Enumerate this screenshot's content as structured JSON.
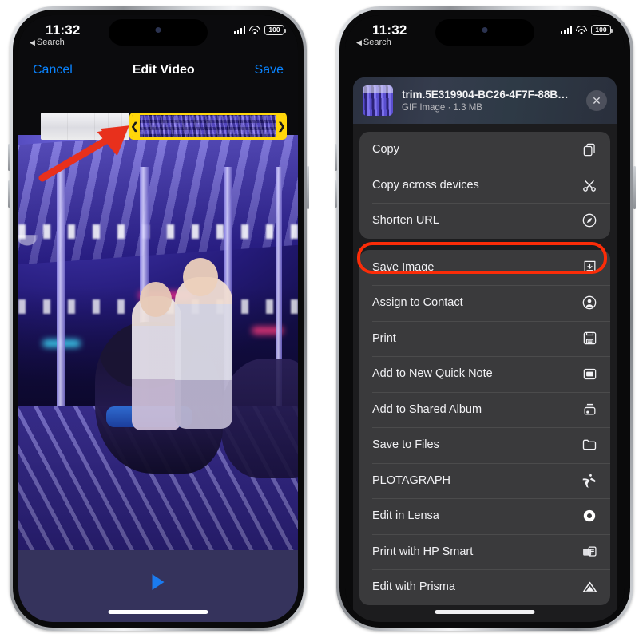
{
  "left_phone": {
    "status_bar": {
      "time": "11:32",
      "back_label": "Search",
      "back_caret": "◀",
      "signal_icon": "cellular-signal-icon",
      "wifi_icon": "wifi-icon",
      "battery_level": "100"
    },
    "navbar": {
      "cancel_label": "Cancel",
      "title": "Edit Video",
      "save_label": "Save"
    },
    "trimmer": {
      "left_handle_glyph": "❮",
      "right_handle_glyph": "❯",
      "selection_border_color": "#ffd60a"
    },
    "player": {
      "play_icon": "play-icon"
    },
    "annotation": {
      "arrow_color": "#e8301c",
      "arrow_name": "red-pointer-arrow"
    }
  },
  "right_phone": {
    "status_bar": {
      "time": "11:32",
      "back_label": "Search",
      "back_caret": "◀",
      "signal_icon": "cellular-signal-icon",
      "wifi_icon": "wifi-icon",
      "battery_level": "100"
    },
    "share_sheet": {
      "header": {
        "file_name": "trim.5E319904-BC26-4F7F-88B…",
        "file_meta": "GIF Image · 1.3 MB",
        "thumbnail_name": "file-thumbnail",
        "close_glyph": "✕"
      },
      "groups": [
        {
          "name": "actions-group-1",
          "items": [
            {
              "label": "Copy",
              "icon": "copy-icon"
            },
            {
              "label": "Copy across devices",
              "icon": "scissors-icon"
            },
            {
              "label": "Shorten URL",
              "icon": "compass-icon"
            }
          ]
        },
        {
          "name": "actions-group-2",
          "items": [
            {
              "label": "Save Image",
              "icon": "save-download-icon",
              "highlighted": true
            },
            {
              "label": "Assign to Contact",
              "icon": "person-circle-icon"
            },
            {
              "label": "Print",
              "icon": "printer-icon"
            },
            {
              "label": "Add to New Quick Note",
              "icon": "quick-note-icon"
            },
            {
              "label": "Add to Shared Album",
              "icon": "shared-album-icon"
            },
            {
              "label": "Save to Files",
              "icon": "folder-icon"
            },
            {
              "label": "PLOTAGRAPH",
              "icon": "plotagraph-icon"
            },
            {
              "label": "Edit in Lensa",
              "icon": "lensa-ring-icon"
            },
            {
              "label": "Print with HP Smart",
              "icon": "hp-smart-printer-icon"
            },
            {
              "label": "Edit with Prisma",
              "icon": "prisma-triangle-icon"
            }
          ]
        }
      ],
      "highlight": {
        "color": "#fb2c08",
        "target": "Save Image"
      }
    }
  }
}
